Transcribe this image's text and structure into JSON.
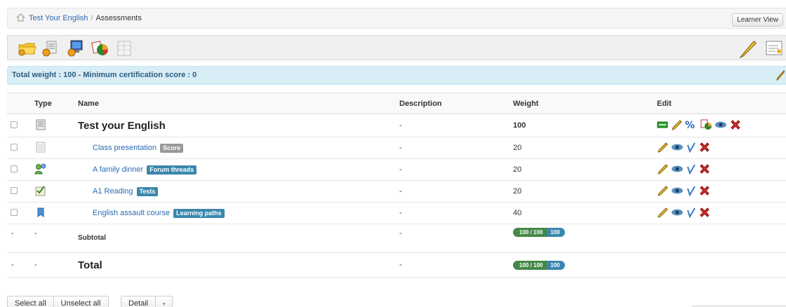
{
  "breadcrumb": {
    "course": "Test Your English",
    "separator": "/",
    "current": "Assessments"
  },
  "learner_view_label": "Learner View",
  "toolbar": {
    "icons": [
      "add-folder-icon",
      "add-document-icon",
      "add-computer-icon",
      "chart-icon",
      "grid-icon"
    ],
    "right_icons": [
      "pencil-icon",
      "settings-icon"
    ]
  },
  "info": {
    "text": "Total weight : 100 - Minimum certification score : 0"
  },
  "table": {
    "headers": {
      "type": "Type",
      "name": "Name",
      "description": "Description",
      "weight": "Weight",
      "edit": "Edit"
    },
    "parent": {
      "name": "Test your English",
      "description": "-",
      "weight": "100"
    },
    "rows": [
      {
        "name": "Class presentation",
        "badge": "Score",
        "description": "-",
        "weight": "20",
        "icon": "document-icon"
      },
      {
        "name": "A family dinner",
        "badge": "Forum threads",
        "description": "-",
        "weight": "20",
        "icon": "users-icon"
      },
      {
        "name": "A1 Reading",
        "badge": "Tests",
        "description": "-",
        "weight": "20",
        "icon": "quiz-icon"
      },
      {
        "name": "English assault course",
        "badge": "Learning paths",
        "description": "-",
        "weight": "40",
        "icon": "learning-path-icon"
      }
    ],
    "subtotal": {
      "dash1": "-",
      "dash2": "-",
      "label": "Subtotal",
      "description": "-",
      "score": "100 / 100",
      "percent": "100"
    },
    "total": {
      "dash1": "-",
      "dash2": "-",
      "label": "Total",
      "description": "-",
      "score": "100 / 100",
      "percent": "100"
    }
  },
  "buttons": {
    "select_all": "Select all",
    "unselect_all": "Unselect all",
    "detail": "Detail",
    "caret": "▼"
  },
  "colors": {
    "link": "#2a6ab4",
    "badge_gray": "#999999",
    "badge_blue": "#3a87ad",
    "progress_green": "#468847",
    "info_bg": "#d9edf7"
  }
}
